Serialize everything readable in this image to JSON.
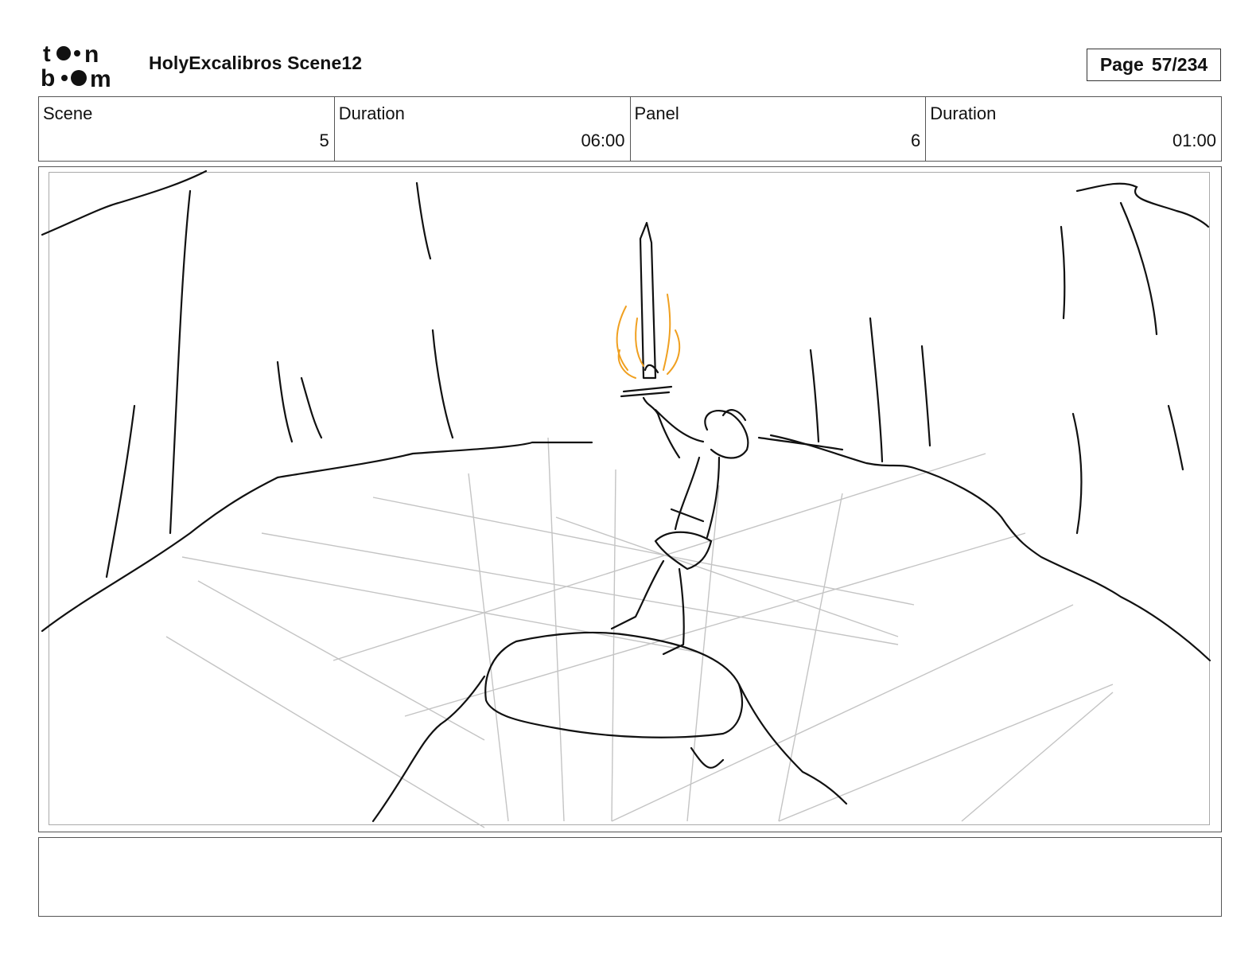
{
  "header": {
    "logo_text": "toonboom",
    "title": "HolyExcalibros Scene12",
    "page_label": "Page",
    "page_number": "57/234"
  },
  "info": {
    "scene_label": "Scene",
    "scene_value": "5",
    "scene_duration_label": "Duration",
    "scene_duration_value": "06:00",
    "panel_label": "Panel",
    "panel_value": "6",
    "panel_duration_label": "Duration",
    "panel_duration_value": "01:00"
  },
  "notes": {
    "text": ""
  },
  "colors": {
    "sketch": "#111111",
    "guides": "#bdbdbd",
    "fire": "#f0a020"
  }
}
